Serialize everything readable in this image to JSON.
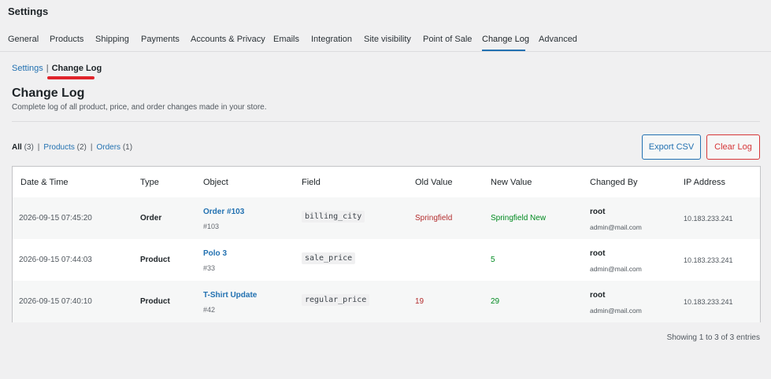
{
  "page": {
    "title": "Settings"
  },
  "tabs": [
    {
      "label": "General"
    },
    {
      "label": "Products"
    },
    {
      "label": "Shipping"
    },
    {
      "label": "Payments"
    },
    {
      "label": "Accounts & Privacy"
    },
    {
      "label": "Emails"
    },
    {
      "label": "Integration"
    },
    {
      "label": "Site visibility"
    },
    {
      "label": "Point of Sale"
    },
    {
      "label": "Change Log"
    },
    {
      "label": "Advanced"
    }
  ],
  "active_tab": "Change Log",
  "breadcrumb": {
    "parent": "Settings",
    "separator": "|",
    "current": "Change Log"
  },
  "section": {
    "title": "Change Log",
    "description": "Complete log of all product, price, and order changes made in your store."
  },
  "filters": {
    "all": {
      "label": "All",
      "count": "(3)"
    },
    "products": {
      "label": "Products",
      "count": "(2)"
    },
    "orders": {
      "label": "Orders",
      "count": "(1)"
    },
    "separator": "|"
  },
  "buttons": {
    "export": "Export CSV",
    "clear": "Clear Log"
  },
  "table": {
    "headers": [
      "Date & Time",
      "Type",
      "Object",
      "Field",
      "Old Value",
      "New Value",
      "Changed By",
      "IP Address"
    ],
    "rows": [
      {
        "date": "2026-09-15 07:45:20",
        "type": "Order",
        "object_title": "Order #103",
        "object_id": "#103",
        "field": "billing_city",
        "old": "Springfield",
        "new": "Springfield New",
        "user": "root",
        "email": "admin@mail.com",
        "ip": "10.183.233.241"
      },
      {
        "date": "2026-09-15 07:44:03",
        "type": "Product",
        "object_title": "Polo 3",
        "object_id": "#33",
        "field": "sale_price",
        "old": "",
        "new": "5",
        "user": "root",
        "email": "admin@mail.com",
        "ip": "10.183.233.241"
      },
      {
        "date": "2026-09-15 07:40:10",
        "type": "Product",
        "object_title": "T-Shirt Update",
        "object_id": "#42",
        "field": "regular_price",
        "old": "19",
        "new": "29",
        "user": "root",
        "email": "admin@mail.com",
        "ip": "10.183.233.241"
      }
    ]
  },
  "footer": {
    "entries": "Showing 1 to 3 of 3 entries"
  },
  "colors": {
    "accent": "#2271b1",
    "danger": "#d63638",
    "success": "#008a20",
    "annotation": "#e0242b"
  }
}
